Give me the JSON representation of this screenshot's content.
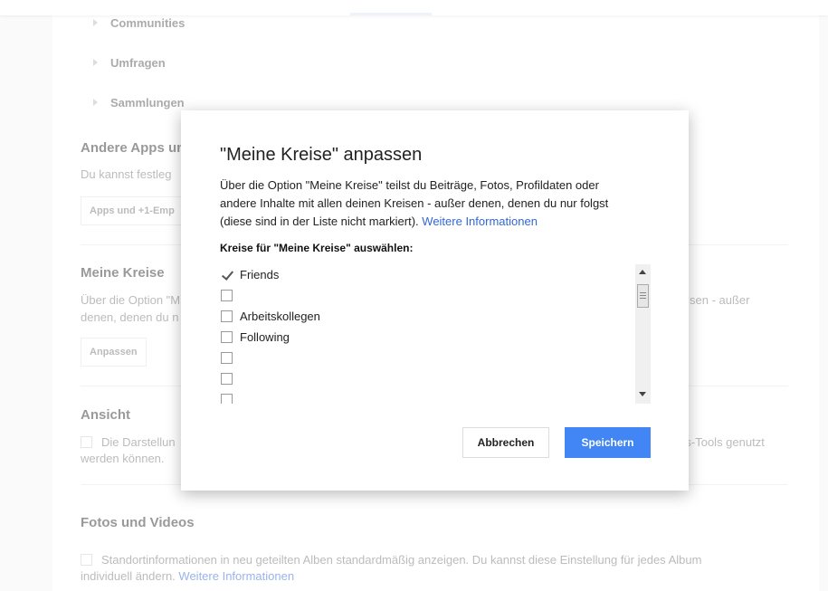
{
  "background": {
    "tab_indicator_color": "#dbe4f7",
    "tree_items": [
      {
        "label": "Communities"
      },
      {
        "label": "Umfragen"
      },
      {
        "label": "Sammlungen"
      }
    ],
    "other_apps": {
      "title": "Andere Apps un",
      "text": "Du kannst festleg",
      "button": "Apps und +1-Emp"
    },
    "my_circles": {
      "title": "Meine Kreise",
      "text_line1": "Über die Option \"M",
      "text_line2": "denen, denen du n",
      "text_right": "sen - außer",
      "button": "Anpassen"
    },
    "view": {
      "title": "Ansicht",
      "text_line1": "Die Darstellun",
      "text_line2": "werden können.",
      "text_right": "ilfs-Tools genutzt"
    },
    "photos": {
      "title": "Fotos und Videos",
      "text_line1": "Standortinformationen in neu geteilten Alben standardmäßig anzeigen. Du kannst diese Einstellung für jedes Album",
      "text_line2": "individuell ändern.",
      "link": "Weitere Informationen"
    }
  },
  "dialog": {
    "title": "\"Meine Kreise\" anpassen",
    "desc_line1": "Über die Option \"Meine Kreise\" teilst du Beiträge, Fotos, Profildaten oder",
    "desc_line2": "andere Inhalte mit allen deinen Kreisen - außer denen, denen du nur folgst",
    "desc_line3": "(diese sind in der Liste nicht markiert).",
    "desc_link": "Weitere Informationen",
    "subtitle": "Kreise für \"Meine Kreise\" auswählen:",
    "circles": [
      {
        "label": "Friends",
        "checked": true
      },
      {
        "label": "",
        "checked": false
      },
      {
        "label": "Arbeitskollegen",
        "checked": false
      },
      {
        "label": "Following",
        "checked": false
      },
      {
        "label": "",
        "checked": false
      },
      {
        "label": "",
        "checked": false
      },
      {
        "label": "",
        "checked": false
      }
    ],
    "cancel_label": "Abbrechen",
    "save_label": "Speichern",
    "accent_color": "#4285f4"
  }
}
